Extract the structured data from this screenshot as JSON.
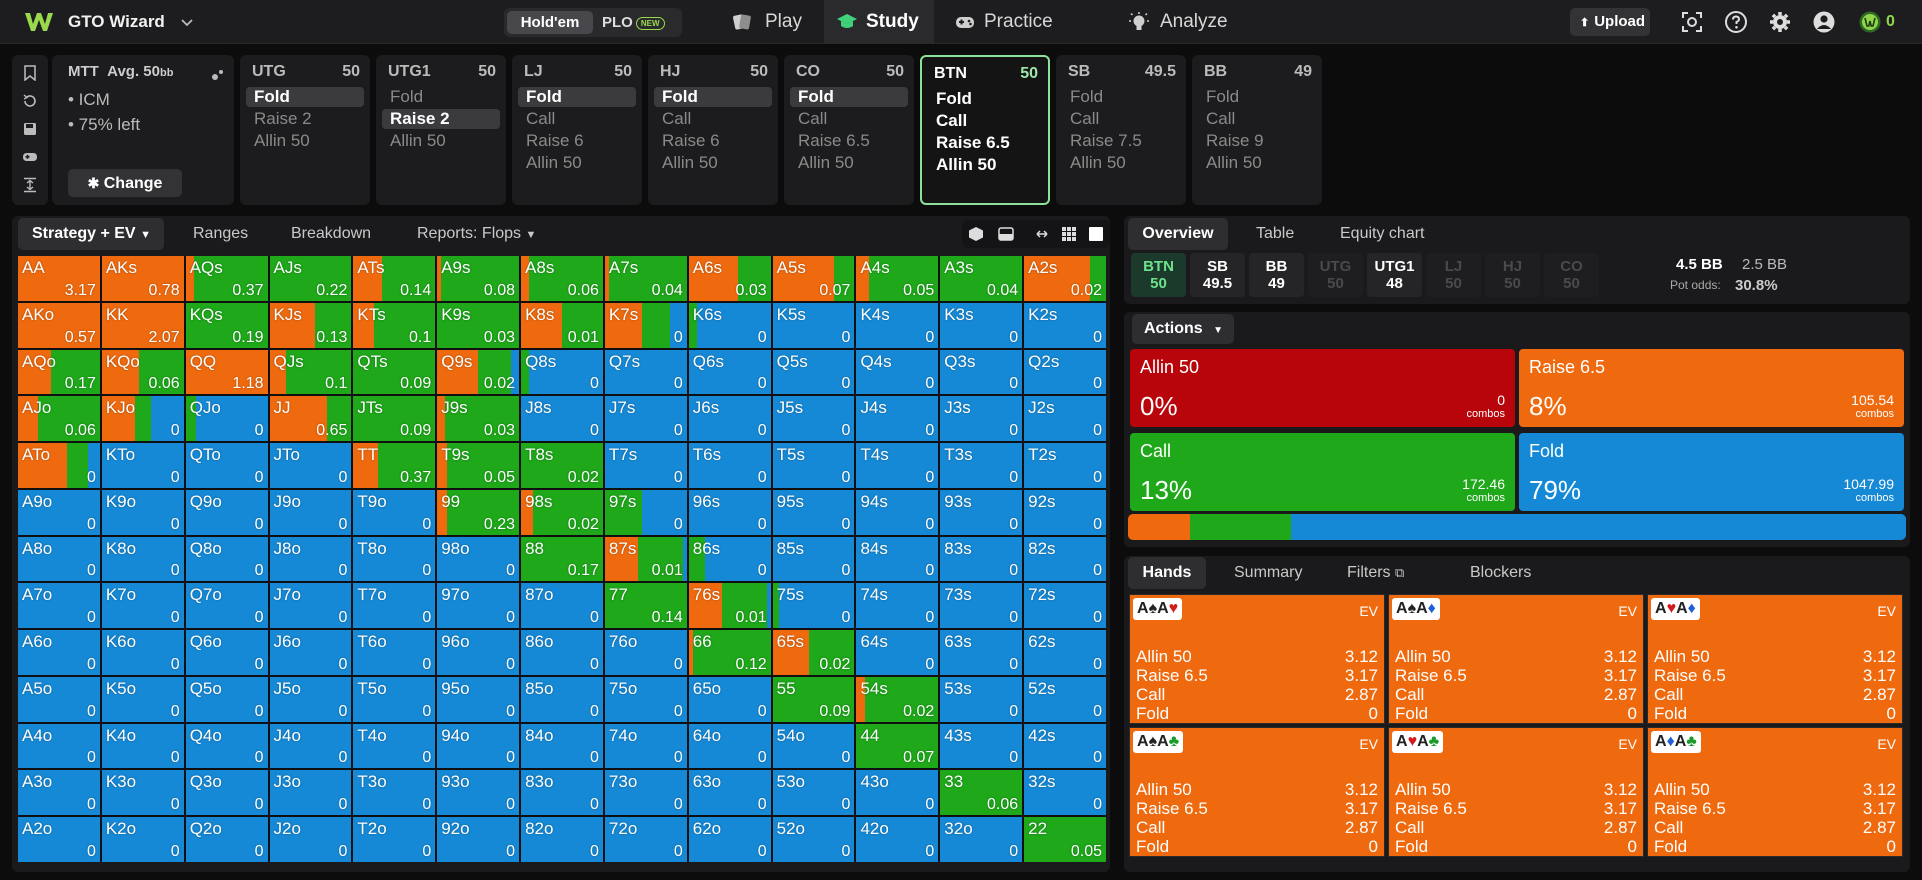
{
  "app": {
    "brand": "GTO Wizard",
    "game_hold": "Hold'em",
    "game_plo": "PLO",
    "game_new": "NEW",
    "credits": "0"
  },
  "nav": [
    {
      "label": "Play",
      "icon": "cards-icon"
    },
    {
      "label": "Study",
      "icon": "mortarboard-icon"
    },
    {
      "label": "Practice",
      "icon": "gamepad-icon"
    },
    {
      "label": "Analyze",
      "icon": "lightbulb-icon"
    }
  ],
  "upload": "Upload",
  "mtt": {
    "title": "MTT",
    "avg": "Avg. 50",
    "avg_unit": "bb",
    "lines": [
      "• ICM",
      "• 75% left"
    ],
    "change": "Change"
  },
  "positions": [
    {
      "name": "UTG",
      "stack": "50",
      "actions": [
        "Fold",
        "Raise 2",
        "Allin 50"
      ],
      "sel": 0
    },
    {
      "name": "UTG1",
      "stack": "50",
      "actions": [
        "Fold",
        "Raise 2",
        "Allin 50"
      ],
      "sel": 1
    },
    {
      "name": "LJ",
      "stack": "50",
      "actions": [
        "Fold",
        "Call",
        "Raise 6",
        "Allin 50"
      ],
      "sel": 0
    },
    {
      "name": "HJ",
      "stack": "50",
      "actions": [
        "Fold",
        "Call",
        "Raise 6",
        "Allin 50"
      ],
      "sel": 0
    },
    {
      "name": "CO",
      "stack": "50",
      "actions": [
        "Fold",
        "Call",
        "Raise 6.5",
        "Allin 50"
      ],
      "sel": 0
    },
    {
      "name": "BTN",
      "stack": "50",
      "actions": [
        "Fold",
        "Call",
        "Raise 6.5",
        "Allin 50"
      ],
      "sel": -1
    },
    {
      "name": "SB",
      "stack": "49.5",
      "actions": [
        "Fold",
        "Call",
        "Raise 7.5",
        "Allin 50"
      ],
      "sel": -1
    },
    {
      "name": "BB",
      "stack": "49",
      "actions": [
        "Fold",
        "Call",
        "Raise 9",
        "Allin 50"
      ],
      "sel": -1
    }
  ],
  "strategy_tabs": [
    "Strategy + EV",
    "Ranges",
    "Breakdown",
    "Reports: Flops"
  ],
  "colors": {
    "allin": "#b8040b",
    "raise": "#ef6a0f",
    "call": "#1ea81a",
    "fold": "#1689d6"
  },
  "grid": [
    [
      [
        "AA",
        "3.17",
        "r"
      ],
      [
        "AKs",
        "0.78",
        "r"
      ],
      [
        "AQs",
        "0.37",
        "rc:10"
      ],
      [
        "AJs",
        "0.22",
        "c"
      ],
      [
        "ATs",
        "0.14",
        "rc:35"
      ],
      [
        "A9s",
        "0.08",
        "rc:5"
      ],
      [
        "A8s",
        "0.06",
        "rc:10"
      ],
      [
        "A7s",
        "0.04",
        "rc:5"
      ],
      [
        "A6s",
        "0.03",
        "rc:60"
      ],
      [
        "A5s",
        "0.07",
        "rc:75"
      ],
      [
        "A4s",
        "0.05",
        "rc:15"
      ],
      [
        "A3s",
        "0.04",
        "c"
      ],
      [
        "A2s",
        "0.02",
        "rc:80"
      ]
    ],
    [
      [
        "AKo",
        "0.57",
        "r"
      ],
      [
        "KK",
        "2.07",
        "r"
      ],
      [
        "KQs",
        "0.19",
        "c"
      ],
      [
        "KJs",
        "0.13",
        "rc:55"
      ],
      [
        "KTs",
        "0.1",
        "rc:25"
      ],
      [
        "K9s",
        "0.03",
        "c"
      ],
      [
        "K8s",
        "0.01",
        "rc:50"
      ],
      [
        "K7s",
        "0",
        "rcf:45:35"
      ],
      [
        "K6s",
        "0",
        "cf:10"
      ],
      [
        "K5s",
        "0",
        "f"
      ],
      [
        "K4s",
        "0",
        "f"
      ],
      [
        "K3s",
        "0",
        "f"
      ],
      [
        "K2s",
        "0",
        "f"
      ]
    ],
    [
      [
        "AQo",
        "0.17",
        "rc:40"
      ],
      [
        "KQo",
        "0.06",
        "rc:45"
      ],
      [
        "QQ",
        "1.18",
        "r"
      ],
      [
        "QJs",
        "0.1",
        "rc:20"
      ],
      [
        "QTs",
        "0.09",
        "c"
      ],
      [
        "Q9s",
        "0.02",
        "rcf:50:40"
      ],
      [
        "Q8s",
        "0",
        "cf:10"
      ],
      [
        "Q7s",
        "0",
        "f"
      ],
      [
        "Q6s",
        "0",
        "f"
      ],
      [
        "Q5s",
        "0",
        "f"
      ],
      [
        "Q4s",
        "0",
        "f"
      ],
      [
        "Q3s",
        "0",
        "f"
      ],
      [
        "Q2s",
        "0",
        "f"
      ]
    ],
    [
      [
        "AJo",
        "0.06",
        "rc:25"
      ],
      [
        "KJo",
        "0",
        "rcf:40:20"
      ],
      [
        "QJo",
        "0",
        "cf:12"
      ],
      [
        "JJ",
        "0.65",
        "rc:70"
      ],
      [
        "JTs",
        "0.09",
        "c"
      ],
      [
        "J9s",
        "0.03",
        "rc:10"
      ],
      [
        "J8s",
        "0",
        "f"
      ],
      [
        "J7s",
        "0",
        "f"
      ],
      [
        "J6s",
        "0",
        "f"
      ],
      [
        "J5s",
        "0",
        "f"
      ],
      [
        "J4s",
        "0",
        "f"
      ],
      [
        "J3s",
        "0",
        "f"
      ],
      [
        "J2s",
        "0",
        "f"
      ]
    ],
    [
      [
        "ATo",
        "0",
        "rcf:60:25"
      ],
      [
        "KTo",
        "0",
        "f"
      ],
      [
        "QTo",
        "0",
        "f"
      ],
      [
        "JTo",
        "0",
        "f"
      ],
      [
        "TT",
        "0.37",
        "rc:30"
      ],
      [
        "T9s",
        "0.05",
        "rc:12"
      ],
      [
        "T8s",
        "0.02",
        "c"
      ],
      [
        "T7s",
        "0",
        "f"
      ],
      [
        "T6s",
        "0",
        "f"
      ],
      [
        "T5s",
        "0",
        "f"
      ],
      [
        "T4s",
        "0",
        "f"
      ],
      [
        "T3s",
        "0",
        "f"
      ],
      [
        "T2s",
        "0",
        "f"
      ]
    ],
    [
      [
        "A9o",
        "0",
        "f"
      ],
      [
        "K9o",
        "0",
        "f"
      ],
      [
        "Q9o",
        "0",
        "f"
      ],
      [
        "J9o",
        "0",
        "f"
      ],
      [
        "T9o",
        "0",
        "f"
      ],
      [
        "99",
        "0.23",
        "rc:12"
      ],
      [
        "98s",
        "0.02",
        "rc:15"
      ],
      [
        "97s",
        "0",
        "cf:45"
      ],
      [
        "96s",
        "0",
        "f"
      ],
      [
        "95s",
        "0",
        "f"
      ],
      [
        "94s",
        "0",
        "f"
      ],
      [
        "93s",
        "0",
        "f"
      ],
      [
        "92s",
        "0",
        "f"
      ]
    ],
    [
      [
        "A8o",
        "0",
        "f"
      ],
      [
        "K8o",
        "0",
        "f"
      ],
      [
        "Q8o",
        "0",
        "f"
      ],
      [
        "J8o",
        "0",
        "f"
      ],
      [
        "T8o",
        "0",
        "f"
      ],
      [
        "98o",
        "0",
        "f"
      ],
      [
        "88",
        "0.17",
        "c"
      ],
      [
        "87s",
        "0.01",
        "rcf:40:55"
      ],
      [
        "86s",
        "0",
        "cf:20"
      ],
      [
        "85s",
        "0",
        "f"
      ],
      [
        "84s",
        "0",
        "f"
      ],
      [
        "83s",
        "0",
        "f"
      ],
      [
        "82s",
        "0",
        "f"
      ]
    ],
    [
      [
        "A7o",
        "0",
        "f"
      ],
      [
        "K7o",
        "0",
        "f"
      ],
      [
        "Q7o",
        "0",
        "f"
      ],
      [
        "J7o",
        "0",
        "f"
      ],
      [
        "T7o",
        "0",
        "f"
      ],
      [
        "97o",
        "0",
        "f"
      ],
      [
        "87o",
        "0",
        "f"
      ],
      [
        "77",
        "0.14",
        "c"
      ],
      [
        "76s",
        "0.01",
        "rcf:40:55"
      ],
      [
        "75s",
        "0",
        "cf:8"
      ],
      [
        "74s",
        "0",
        "f"
      ],
      [
        "73s",
        "0",
        "f"
      ],
      [
        "72s",
        "0",
        "f"
      ]
    ],
    [
      [
        "A6o",
        "0",
        "f"
      ],
      [
        "K6o",
        "0",
        "f"
      ],
      [
        "Q6o",
        "0",
        "f"
      ],
      [
        "J6o",
        "0",
        "f"
      ],
      [
        "T6o",
        "0",
        "f"
      ],
      [
        "96o",
        "0",
        "f"
      ],
      [
        "86o",
        "0",
        "f"
      ],
      [
        "76o",
        "0",
        "f"
      ],
      [
        "66",
        "0.12",
        "rc:5"
      ],
      [
        "65s",
        "0.02",
        "rc:45"
      ],
      [
        "64s",
        "0",
        "f"
      ],
      [
        "63s",
        "0",
        "f"
      ],
      [
        "62s",
        "0",
        "f"
      ]
    ],
    [
      [
        "A5o",
        "0",
        "f"
      ],
      [
        "K5o",
        "0",
        "f"
      ],
      [
        "Q5o",
        "0",
        "f"
      ],
      [
        "J5o",
        "0",
        "f"
      ],
      [
        "T5o",
        "0",
        "f"
      ],
      [
        "95o",
        "0",
        "f"
      ],
      [
        "85o",
        "0",
        "f"
      ],
      [
        "75o",
        "0",
        "f"
      ],
      [
        "65o",
        "0",
        "f"
      ],
      [
        "55",
        "0.09",
        "c"
      ],
      [
        "54s",
        "0.02",
        "rc:10"
      ],
      [
        "53s",
        "0",
        "f"
      ],
      [
        "52s",
        "0",
        "f"
      ]
    ],
    [
      [
        "A4o",
        "0",
        "f"
      ],
      [
        "K4o",
        "0",
        "f"
      ],
      [
        "Q4o",
        "0",
        "f"
      ],
      [
        "J4o",
        "0",
        "f"
      ],
      [
        "T4o",
        "0",
        "f"
      ],
      [
        "94o",
        "0",
        "f"
      ],
      [
        "84o",
        "0",
        "f"
      ],
      [
        "74o",
        "0",
        "f"
      ],
      [
        "64o",
        "0",
        "f"
      ],
      [
        "54o",
        "0",
        "f"
      ],
      [
        "44",
        "0.07",
        "c"
      ],
      [
        "43s",
        "0",
        "f"
      ],
      [
        "42s",
        "0",
        "f"
      ]
    ],
    [
      [
        "A3o",
        "0",
        "f"
      ],
      [
        "K3o",
        "0",
        "f"
      ],
      [
        "Q3o",
        "0",
        "f"
      ],
      [
        "J3o",
        "0",
        "f"
      ],
      [
        "T3o",
        "0",
        "f"
      ],
      [
        "93o",
        "0",
        "f"
      ],
      [
        "83o",
        "0",
        "f"
      ],
      [
        "73o",
        "0",
        "f"
      ],
      [
        "63o",
        "0",
        "f"
      ],
      [
        "53o",
        "0",
        "f"
      ],
      [
        "43o",
        "0",
        "f"
      ],
      [
        "33",
        "0.06",
        "c"
      ],
      [
        "32s",
        "0",
        "f"
      ]
    ],
    [
      [
        "A2o",
        "0",
        "f"
      ],
      [
        "K2o",
        "0",
        "f"
      ],
      [
        "Q2o",
        "0",
        "f"
      ],
      [
        "J2o",
        "0",
        "f"
      ],
      [
        "T2o",
        "0",
        "f"
      ],
      [
        "92o",
        "0",
        "f"
      ],
      [
        "82o",
        "0",
        "f"
      ],
      [
        "72o",
        "0",
        "f"
      ],
      [
        "62o",
        "0",
        "f"
      ],
      [
        "52o",
        "0",
        "f"
      ],
      [
        "42o",
        "0",
        "f"
      ],
      [
        "32o",
        "0",
        "f"
      ],
      [
        "22",
        "0.05",
        "c"
      ]
    ]
  ],
  "right_tabs": [
    "Overview",
    "Table",
    "Equity chart"
  ],
  "players": [
    {
      "name": "BTN",
      "stack": "50",
      "state": "active"
    },
    {
      "name": "SB",
      "stack": "49.5",
      "state": "normal"
    },
    {
      "name": "BB",
      "stack": "49",
      "state": "normal"
    },
    {
      "name": "UTG",
      "stack": "50",
      "state": "dim"
    },
    {
      "name": "UTG1",
      "stack": "48",
      "state": "normal"
    },
    {
      "name": "LJ",
      "stack": "50",
      "state": "dim"
    },
    {
      "name": "HJ",
      "stack": "50",
      "state": "dim"
    },
    {
      "name": "CO",
      "stack": "50",
      "state": "dim"
    }
  ],
  "pot": {
    "pot": "4.5 BB",
    "tocall": "2.5 BB",
    "odds_label": "Pot odds:",
    "odds": "30.8%"
  },
  "actions_label": "Actions",
  "action_boxes": [
    {
      "name": "Allin 50",
      "pct": "0%",
      "combos": "0",
      "key": "allin",
      "frac": 0
    },
    {
      "name": "Raise 6.5",
      "pct": "8%",
      "combos": "105.54",
      "key": "raise",
      "frac": 0.08
    },
    {
      "name": "Call",
      "pct": "13%",
      "combos": "172.46",
      "key": "call",
      "frac": 0.13
    },
    {
      "name": "Fold",
      "pct": "79%",
      "combos": "1047.99",
      "key": "fold",
      "frac": 0.79
    }
  ],
  "combos_label": "combos",
  "hands_tabs": [
    "Hands",
    "Summary",
    "Filters",
    "Blockers"
  ],
  "hand_cards": [
    {
      "c1": "A",
      "s1": "♠",
      "col1": "#222",
      "c2": "A",
      "s2": "♥",
      "col2": "#d01c1c"
    },
    {
      "c1": "A",
      "s1": "♠",
      "col1": "#222",
      "c2": "A",
      "s2": "♦",
      "col2": "#1f5fd6"
    },
    {
      "c1": "A",
      "s1": "♥",
      "col1": "#d01c1c",
      "c2": "A",
      "s2": "♦",
      "col2": "#1f5fd6"
    },
    {
      "c1": "A",
      "s1": "♠",
      "col1": "#222",
      "c2": "A",
      "s2": "♣",
      "col2": "#1a9a2a"
    },
    {
      "c1": "A",
      "s1": "♥",
      "col1": "#d01c1c",
      "c2": "A",
      "s2": "♣",
      "col2": "#1a9a2a"
    },
    {
      "c1": "A",
      "s1": "♦",
      "col1": "#1f5fd6",
      "c2": "A",
      "s2": "♣",
      "col2": "#1a9a2a"
    }
  ],
  "hand_ev_label": "EV",
  "hand_rows": [
    {
      "label": "Allin 50",
      "ev": "3.12"
    },
    {
      "label": "Raise 6.5",
      "ev": "3.17"
    },
    {
      "label": "Call",
      "ev": "2.87"
    },
    {
      "label": "Fold",
      "ev": "0"
    }
  ]
}
